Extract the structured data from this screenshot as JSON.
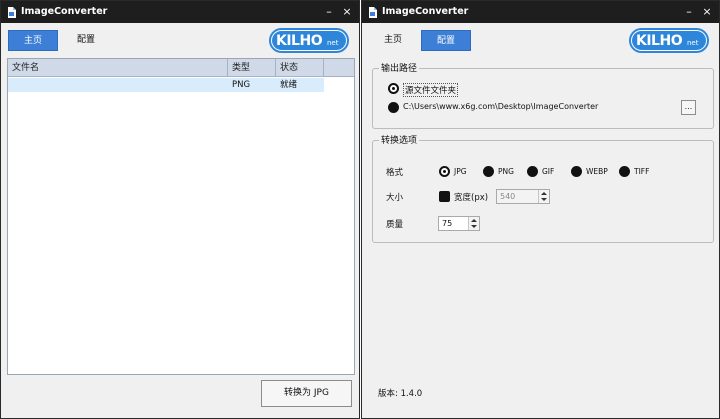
{
  "left_window": {
    "title": "ImageConverter",
    "minimize": "–",
    "close": "×",
    "tabs": [
      {
        "label": "主页",
        "active": true
      },
      {
        "label": "配置",
        "active": false
      }
    ],
    "logo": {
      "main": "KILHO",
      "suffix": "net"
    },
    "file_table": {
      "columns": [
        "文件名",
        "类型",
        "状态"
      ],
      "rows": [
        {
          "name": "",
          "type": "PNG",
          "status": "就绪"
        }
      ]
    },
    "convert_button": "转换为 JPG"
  },
  "right_window": {
    "title": "ImageConverter",
    "minimize": "–",
    "close": "×",
    "tabs": [
      {
        "label": "主页",
        "active": false
      },
      {
        "label": "配置",
        "active": true
      }
    ],
    "logo": {
      "main": "KILHO",
      "suffix": "net"
    },
    "output_group": {
      "title": "输出路径",
      "options": [
        {
          "label": "源文件文件夹",
          "selected": true
        },
        {
          "label": "C:\\Users\\www.x6g.com\\Desktop\\ImageConverter",
          "selected": false
        }
      ],
      "browse_label": "..."
    },
    "convert_group": {
      "title": "转换选项",
      "format_label": "格式",
      "formats": [
        {
          "label": "JPG",
          "selected": true
        },
        {
          "label": "PNG",
          "selected": false
        },
        {
          "label": "GIF",
          "selected": false
        },
        {
          "label": "WEBP",
          "selected": false
        },
        {
          "label": "TIFF",
          "selected": false
        }
      ],
      "size_label": "大小",
      "width_checkbox_label": "宽度(px)",
      "width_value": "540",
      "quality_label": "质量",
      "quality_value": "75"
    },
    "version": "版本: 1.4.0"
  },
  "colors": {
    "titlebar": "#1e1e1e",
    "accent": "#3d7fd6",
    "table_header": "#cfd9e8",
    "selected_row": "#d8ecfb",
    "window_bg": "#f0f0f0"
  }
}
